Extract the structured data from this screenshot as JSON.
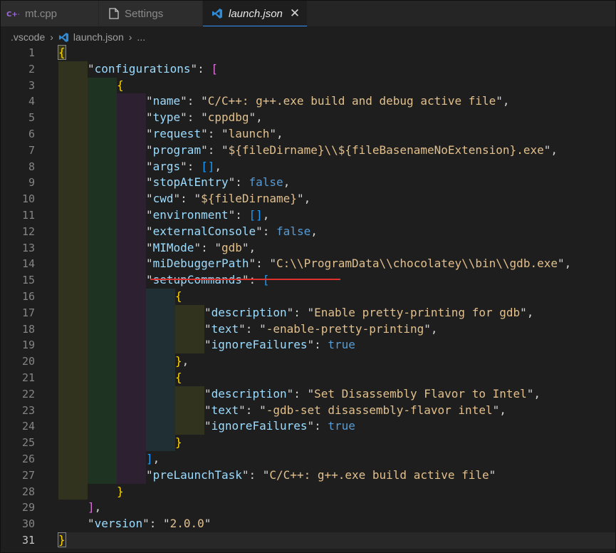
{
  "tabs": [
    {
      "label": "mt.cpp",
      "icon": "cpp-file-icon",
      "active": false
    },
    {
      "label": "Settings",
      "icon": "settings-file-icon",
      "active": false
    },
    {
      "label": "launch.json",
      "icon": "vscode-icon",
      "active": true,
      "close": "✕"
    }
  ],
  "breadcrumb": {
    "folder": ".vscode",
    "file": "launch.json",
    "more": "..."
  },
  "editor": {
    "current_line": 31,
    "line_numbers": [
      "1",
      "2",
      "3",
      "4",
      "5",
      "6",
      "7",
      "8",
      "9",
      "10",
      "11",
      "12",
      "13",
      "14",
      "15",
      "16",
      "17",
      "18",
      "19",
      "20",
      "21",
      "22",
      "23",
      "24",
      "25",
      "26",
      "27",
      "28",
      "29",
      "30",
      "31"
    ],
    "keys": {
      "configurations": "configurations",
      "name": "name",
      "type": "type",
      "request": "request",
      "program": "program",
      "args": "args",
      "stopAtEntry": "stopAtEntry",
      "cwd": "cwd",
      "environment": "environment",
      "externalConsole": "externalConsole",
      "MIMode": "MIMode",
      "miDebuggerPath": "miDebuggerPath",
      "setupCommands": "setupCommands",
      "description": "description",
      "text": "text",
      "ignoreFailures": "ignoreFailures",
      "preLaunchTask": "preLaunchTask",
      "version": "version"
    },
    "values": {
      "name": "C/C++: g++.exe build and debug active file",
      "type": "cppdbg",
      "request": "launch",
      "program": "${fileDirname}\\\\${fileBasenameNoExtension}.exe",
      "args": "[]",
      "stopAtEntry": "false",
      "cwd": "${fileDirname}",
      "environment": "[]",
      "externalConsole": "false",
      "MIMode": "gdb",
      "miDebuggerPath": "C:\\\\ProgramData\\\\chocolatey\\\\bin\\\\gdb.exe",
      "desc1": "Enable pretty-printing for gdb",
      "text1": "-enable-pretty-printing",
      "ignore1": "true",
      "desc2": "Set Disassembly Flavor to Intel",
      "text2": "-gdb-set disassembly-flavor intel",
      "ignore2": "true",
      "preLaunchTask": "C/C++: g++.exe build active file",
      "version": "2.0.0"
    }
  },
  "colors": {
    "background": "#1e1e1e",
    "key": "#9cdcfe",
    "string": "#e2c08d",
    "keyword": "#569cd6",
    "underline": "#e0302c",
    "accent": "#3794ff"
  }
}
